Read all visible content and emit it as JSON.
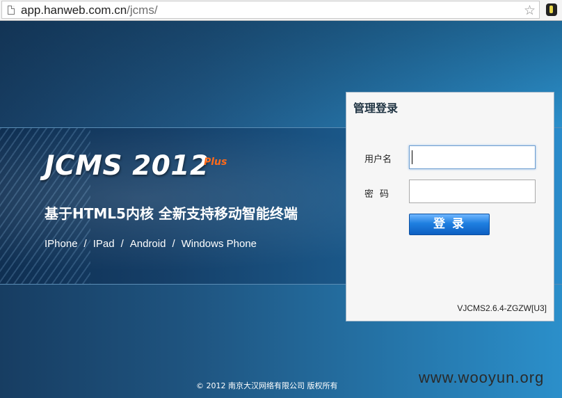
{
  "browser": {
    "url_host": "app.hanweb.com.cn",
    "url_path": "/jcms/",
    "icons": [
      "page-icon",
      "bookmark-star-icon",
      "extension-icon"
    ]
  },
  "banner": {
    "title": "JCMS 2012",
    "plus": "Plus",
    "subtitle": "基于HTML5内核 全新支持移动智能终端",
    "platforms": [
      "IPhone",
      "IPad",
      "Android",
      "Windows Phone"
    ],
    "separator": "/"
  },
  "login": {
    "title": "管理登录",
    "username_label": "用户名",
    "password_label": "密码",
    "username_value": "",
    "password_value": "",
    "submit_label": "登录",
    "version": "VJCMS2.6.4-ZGZW[U3]"
  },
  "footer": {
    "copyright": "© 2012 南京大汉网络有限公司 版权所有"
  },
  "watermark": "www.wooyun.org",
  "colors": {
    "plus_accent": "#ff6a1a",
    "button_blue": "#1f7fe0",
    "background_blue": "#1f5581"
  }
}
